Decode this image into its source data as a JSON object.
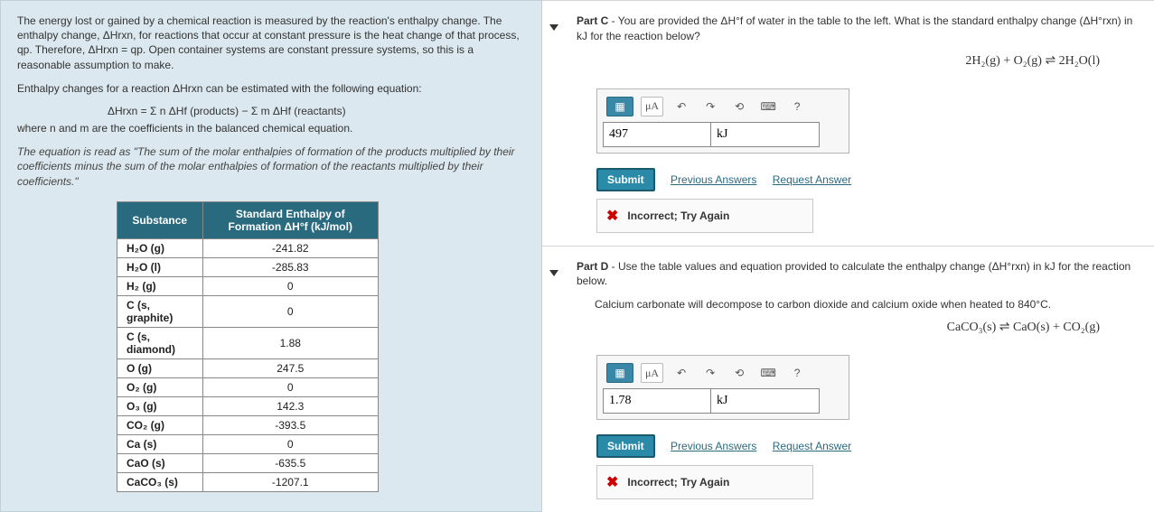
{
  "left": {
    "p1": "The energy lost or gained by a chemical reaction is measured by the reaction's enthalpy change. The enthalpy change, ΔHrxn, for reactions that occur at constant pressure is the heat change of that process, qp. Therefore, ΔHrxn = qp. Open container systems are constant pressure systems, so this is a reasonable assumption to make.",
    "p2": "Enthalpy changes for a reaction ΔHrxn can be estimated with the following equation:",
    "eq": "ΔHrxn = Σ n ΔHf (products) − Σ m ΔHf (reactants)",
    "p3": "where n and m are the coefficients in the balanced chemical equation.",
    "p4": "The equation is read as \"The sum of the molar enthalpies of formation of the products multiplied by their coefficients minus the sum of the molar enthalpies of formation of the reactants multiplied by their coefficients.\"",
    "th1": "Substance",
    "th2": "Standard Enthalpy of Formation ΔH°f (kJ/mol)",
    "rows": [
      {
        "s": "H₂O (g)",
        "v": "-241.82"
      },
      {
        "s": "H₂O (l)",
        "v": "-285.83"
      },
      {
        "s": "H₂ (g)",
        "v": "0"
      },
      {
        "s": "C (s, graphite)",
        "v": "0"
      },
      {
        "s": "C (s, diamond)",
        "v": "1.88"
      },
      {
        "s": "O (g)",
        "v": "247.5"
      },
      {
        "s": "O₂ (g)",
        "v": "0"
      },
      {
        "s": "O₃ (g)",
        "v": "142.3"
      },
      {
        "s": "CO₂ (g)",
        "v": "-393.5"
      },
      {
        "s": "Ca (s)",
        "v": "0"
      },
      {
        "s": "CaO (s)",
        "v": "-635.5"
      },
      {
        "s": "CaCO₃ (s)",
        "v": "-1207.1"
      }
    ]
  },
  "partC": {
    "label": "Part C",
    "prompt": " - You are provided the ΔH°f of water in the table to the left. What is the standard enthalpy change (ΔH°rxn) in kJ for the reaction below?",
    "equation": "2H₂(g) + O₂(g)  ⇌  2H₂O(l)",
    "microA": "μA",
    "help": "?",
    "value": "497",
    "unit": "kJ",
    "submit": "Submit",
    "prev": "Previous Answers",
    "req": "Request Answer",
    "feedback": "Incorrect; Try Again"
  },
  "partD": {
    "label": "Part D",
    "prompt": " - Use the table values and equation provided to calculate the enthalpy change (ΔH°rxn) in kJ for the reaction below.",
    "line2": "Calcium carbonate will decompose to carbon dioxide and calcium oxide when heated to 840°C.",
    "equation": "CaCO₃(s)  ⇌  CaO(s) + CO₂(g)",
    "microA": "μA",
    "help": "?",
    "value": "1.78",
    "unit": "kJ",
    "submit": "Submit",
    "prev": "Previous Answers",
    "req": "Request Answer",
    "feedback": "Incorrect; Try Again"
  }
}
